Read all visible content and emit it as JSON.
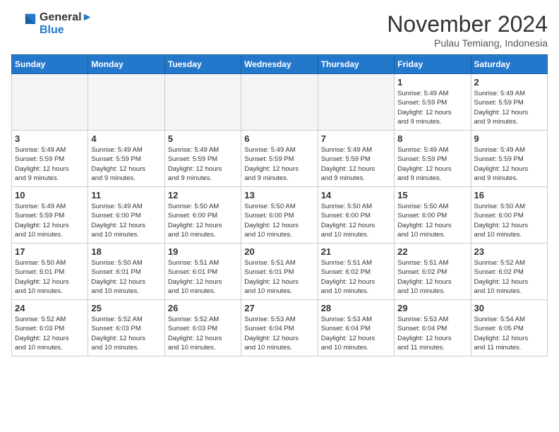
{
  "header": {
    "logo_line1": "General",
    "logo_line2": "Blue",
    "month": "November 2024",
    "location": "Pulau Temiang, Indonesia"
  },
  "days_of_week": [
    "Sunday",
    "Monday",
    "Tuesday",
    "Wednesday",
    "Thursday",
    "Friday",
    "Saturday"
  ],
  "weeks": [
    [
      {
        "day": "",
        "info": "",
        "empty": true
      },
      {
        "day": "",
        "info": "",
        "empty": true
      },
      {
        "day": "",
        "info": "",
        "empty": true
      },
      {
        "day": "",
        "info": "",
        "empty": true
      },
      {
        "day": "",
        "info": "",
        "empty": true
      },
      {
        "day": "1",
        "info": "Sunrise: 5:49 AM\nSunset: 5:59 PM\nDaylight: 12 hours\nand 9 minutes.",
        "empty": false
      },
      {
        "day": "2",
        "info": "Sunrise: 5:49 AM\nSunset: 5:59 PM\nDaylight: 12 hours\nand 9 minutes.",
        "empty": false
      }
    ],
    [
      {
        "day": "3",
        "info": "Sunrise: 5:49 AM\nSunset: 5:59 PM\nDaylight: 12 hours\nand 9 minutes.",
        "empty": false
      },
      {
        "day": "4",
        "info": "Sunrise: 5:49 AM\nSunset: 5:59 PM\nDaylight: 12 hours\nand 9 minutes.",
        "empty": false
      },
      {
        "day": "5",
        "info": "Sunrise: 5:49 AM\nSunset: 5:59 PM\nDaylight: 12 hours\nand 9 minutes.",
        "empty": false
      },
      {
        "day": "6",
        "info": "Sunrise: 5:49 AM\nSunset: 5:59 PM\nDaylight: 12 hours\nand 9 minutes.",
        "empty": false
      },
      {
        "day": "7",
        "info": "Sunrise: 5:49 AM\nSunset: 5:59 PM\nDaylight: 12 hours\nand 9 minutes.",
        "empty": false
      },
      {
        "day": "8",
        "info": "Sunrise: 5:49 AM\nSunset: 5:59 PM\nDaylight: 12 hours\nand 9 minutes.",
        "empty": false
      },
      {
        "day": "9",
        "info": "Sunrise: 5:49 AM\nSunset: 5:59 PM\nDaylight: 12 hours\nand 9 minutes.",
        "empty": false
      }
    ],
    [
      {
        "day": "10",
        "info": "Sunrise: 5:49 AM\nSunset: 5:59 PM\nDaylight: 12 hours\nand 10 minutes.",
        "empty": false
      },
      {
        "day": "11",
        "info": "Sunrise: 5:49 AM\nSunset: 6:00 PM\nDaylight: 12 hours\nand 10 minutes.",
        "empty": false
      },
      {
        "day": "12",
        "info": "Sunrise: 5:50 AM\nSunset: 6:00 PM\nDaylight: 12 hours\nand 10 minutes.",
        "empty": false
      },
      {
        "day": "13",
        "info": "Sunrise: 5:50 AM\nSunset: 6:00 PM\nDaylight: 12 hours\nand 10 minutes.",
        "empty": false
      },
      {
        "day": "14",
        "info": "Sunrise: 5:50 AM\nSunset: 6:00 PM\nDaylight: 12 hours\nand 10 minutes.",
        "empty": false
      },
      {
        "day": "15",
        "info": "Sunrise: 5:50 AM\nSunset: 6:00 PM\nDaylight: 12 hours\nand 10 minutes.",
        "empty": false
      },
      {
        "day": "16",
        "info": "Sunrise: 5:50 AM\nSunset: 6:00 PM\nDaylight: 12 hours\nand 10 minutes.",
        "empty": false
      }
    ],
    [
      {
        "day": "17",
        "info": "Sunrise: 5:50 AM\nSunset: 6:01 PM\nDaylight: 12 hours\nand 10 minutes.",
        "empty": false
      },
      {
        "day": "18",
        "info": "Sunrise: 5:50 AM\nSunset: 6:01 PM\nDaylight: 12 hours\nand 10 minutes.",
        "empty": false
      },
      {
        "day": "19",
        "info": "Sunrise: 5:51 AM\nSunset: 6:01 PM\nDaylight: 12 hours\nand 10 minutes.",
        "empty": false
      },
      {
        "day": "20",
        "info": "Sunrise: 5:51 AM\nSunset: 6:01 PM\nDaylight: 12 hours\nand 10 minutes.",
        "empty": false
      },
      {
        "day": "21",
        "info": "Sunrise: 5:51 AM\nSunset: 6:02 PM\nDaylight: 12 hours\nand 10 minutes.",
        "empty": false
      },
      {
        "day": "22",
        "info": "Sunrise: 5:51 AM\nSunset: 6:02 PM\nDaylight: 12 hours\nand 10 minutes.",
        "empty": false
      },
      {
        "day": "23",
        "info": "Sunrise: 5:52 AM\nSunset: 6:02 PM\nDaylight: 12 hours\nand 10 minutes.",
        "empty": false
      }
    ],
    [
      {
        "day": "24",
        "info": "Sunrise: 5:52 AM\nSunset: 6:03 PM\nDaylight: 12 hours\nand 10 minutes.",
        "empty": false
      },
      {
        "day": "25",
        "info": "Sunrise: 5:52 AM\nSunset: 6:03 PM\nDaylight: 12 hours\nand 10 minutes.",
        "empty": false
      },
      {
        "day": "26",
        "info": "Sunrise: 5:52 AM\nSunset: 6:03 PM\nDaylight: 12 hours\nand 10 minutes.",
        "empty": false
      },
      {
        "day": "27",
        "info": "Sunrise: 5:53 AM\nSunset: 6:04 PM\nDaylight: 12 hours\nand 10 minutes.",
        "empty": false
      },
      {
        "day": "28",
        "info": "Sunrise: 5:53 AM\nSunset: 6:04 PM\nDaylight: 12 hours\nand 10 minutes.",
        "empty": false
      },
      {
        "day": "29",
        "info": "Sunrise: 5:53 AM\nSunset: 6:04 PM\nDaylight: 12 hours\nand 11 minutes.",
        "empty": false
      },
      {
        "day": "30",
        "info": "Sunrise: 5:54 AM\nSunset: 6:05 PM\nDaylight: 12 hours\nand 11 minutes.",
        "empty": false
      }
    ]
  ]
}
